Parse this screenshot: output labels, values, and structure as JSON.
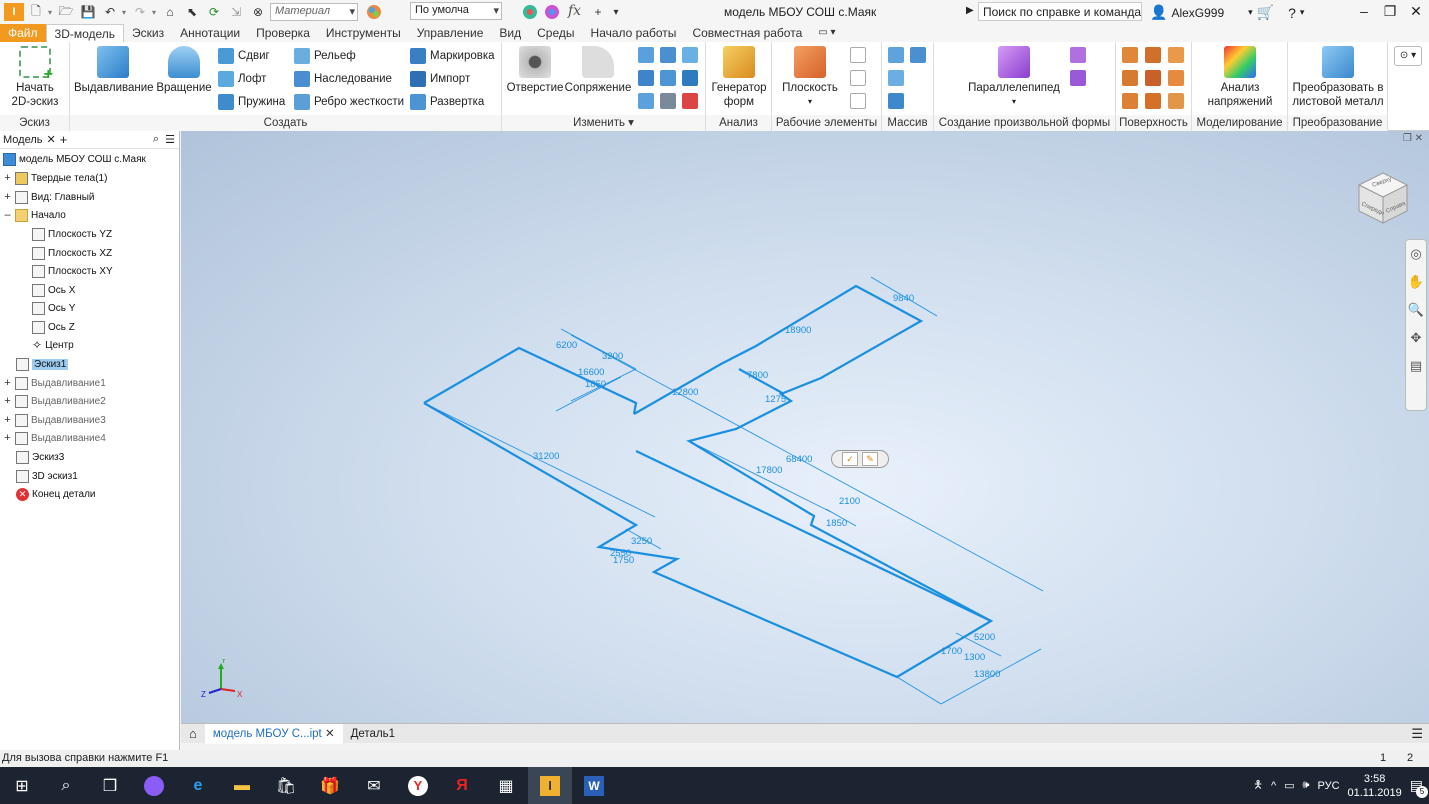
{
  "title_bar": {
    "material_placeholder": "Материал",
    "appearance_value": "По умолча",
    "fx_label": "fx",
    "document_title": "модель МБОУ СОШ с.Маяк",
    "search_text": "Поиск по справке и командам",
    "user_name": "AlexG999"
  },
  "ribbon_tabs": [
    "Файл",
    "3D-модель",
    "Эскиз",
    "Аннотации",
    "Проверка",
    "Инструменты",
    "Управление",
    "Вид",
    "Среды",
    "Начало работы",
    "Совместная работа"
  ],
  "ribbon": {
    "sketch_panel": {
      "start_sketch": "Начать",
      "start_sketch_2": "2D-эскиз",
      "label": "Эскиз"
    },
    "create_panel": {
      "extrude": "Выдавливание",
      "revolve": "Вращение",
      "sweep": "Сдвиг",
      "loft": "Лофт",
      "coil": "Пружина",
      "emboss": "Рельеф",
      "derive": "Наследование",
      "rib": "Ребро жесткости",
      "mark": "Маркировка",
      "import": "Импорт",
      "unwrap": "Развертка",
      "label": "Создать"
    },
    "modify_panel": {
      "hole": "Отверстие",
      "fillet": "Сопряжение",
      "label": "Изменить"
    },
    "explore_panel": {
      "shape_gen": "Генератор",
      "shape_gen_2": "форм",
      "label": "Анализ"
    },
    "work_features_panel": {
      "plane": "Плоскость",
      "label": "Рабочие элементы"
    },
    "pattern_panel": {
      "label": "Массив"
    },
    "freeform_panel": {
      "box": "Параллелепипед",
      "label": "Создание произвольной формы"
    },
    "surface_panel": {
      "label": "Поверхность"
    },
    "simulation_panel": {
      "stress": "Анализ",
      "stress_2": "напряжений",
      "label": "Моделирование"
    },
    "convert_panel": {
      "sheet": "Преобразовать в",
      "sheet_2": "листовой металл",
      "label": "Преобразование"
    }
  },
  "browser": {
    "tab_label": "Модель",
    "items": [
      {
        "label": "модель МБОУ СОШ с.Маяк"
      },
      {
        "label": "Твердые тела(1)"
      },
      {
        "label": "Вид: Главный"
      },
      {
        "label": "Начало"
      },
      {
        "label": "Плоскость YZ"
      },
      {
        "label": "Плоскость XZ"
      },
      {
        "label": "Плоскость XY"
      },
      {
        "label": "Ось X"
      },
      {
        "label": "Ось Y"
      },
      {
        "label": "Ось Z"
      },
      {
        "label": "Центр"
      },
      {
        "label": "Эскиз1"
      },
      {
        "label": "Выдавливание1"
      },
      {
        "label": "Выдавливание2"
      },
      {
        "label": "Выдавливание3"
      },
      {
        "label": "Выдавливание4"
      },
      {
        "label": "Эскиз3"
      },
      {
        "label": "3D эскиз1"
      },
      {
        "label": "Конец детали"
      }
    ]
  },
  "viewcube": {
    "top": "Сверху",
    "front": "Спереди",
    "right": "Справа"
  },
  "dimensions": [
    "9840",
    "18900",
    "6200",
    "3200",
    "16600",
    "1850",
    "7800",
    "12800",
    "1275",
    "31200",
    "68400",
    "17800",
    "2100",
    "1850",
    "3250",
    "2550",
    "1750",
    "5200",
    "1700",
    "1300",
    "13800"
  ],
  "doc_tabs": {
    "active": "модель МБОУ С...ipt",
    "other": "Деталь1"
  },
  "status": {
    "help_text": "Для вызова справки нажмите F1",
    "page1": "1",
    "page2": "2"
  },
  "taskbar": {
    "lang": "РУС",
    "time": "3:58",
    "date": "01.11.2019",
    "notif_count": "5"
  }
}
